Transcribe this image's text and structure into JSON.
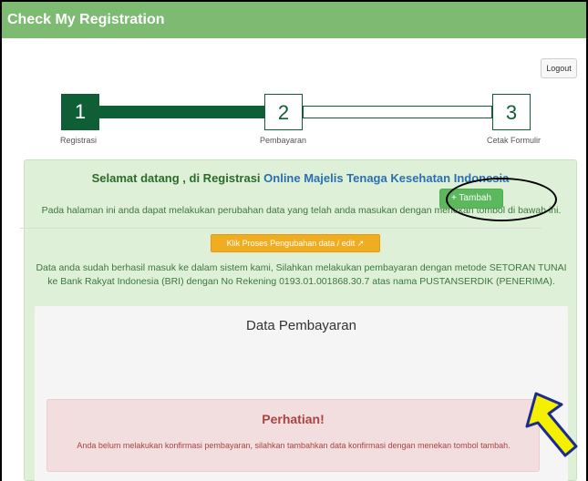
{
  "header": {
    "title": "Check My Registration"
  },
  "toolbar": {
    "logout_label": "Logout"
  },
  "stepper": {
    "steps": [
      {
        "number": "1",
        "label": "Registrasi"
      },
      {
        "number": "2",
        "label": "Pembayaran"
      },
      {
        "number": "3",
        "label": "Cetak Formulir"
      }
    ]
  },
  "welcome": {
    "title_prefix": "Selamat datang , di Registrasi ",
    "title_link": "Online Majelis Tenaga Kesehatan Indonesia",
    "paragraph1": "Pada halaman ini anda dapat melakukan perubahan data yang telah anda masukan dengan menekan tombol di bawah ini.",
    "edit_button": "Klik Proses Pengubahan data / edit",
    "paragraph2": "Data anda sudah berhasil masuk ke dalam sistem kami, Silahkan melakukan pembayaran dengan metode SETORAN TUNAI ke Bank Rakyat Indonesia (BRI) dengan No Rekening 0193.01.001868.30.7 atas nama PUSTANSERDIK (PENERIMA)."
  },
  "payment": {
    "title": "Data Pembayaran",
    "add_button": "+ Tambah"
  },
  "alert": {
    "title": "Perhatian!",
    "text": "Anda belum melakukan konfirmasi pembayaran, silahkan tambahkan data konfirmasi dengan menekan tombol tambah."
  },
  "colors": {
    "header": "#7dbb72",
    "step_active": "#0f5f36",
    "success_bg": "#dff0d8",
    "warning_button": "#f0ad1f",
    "add_button": "#5cb85c",
    "alert_bg": "#f2dede",
    "alert_text": "#a94442",
    "annotation_arrow": "#f5f000"
  },
  "icons": {
    "edit": "edit-external-icon",
    "annotation": "pointer-arrow-icon"
  }
}
